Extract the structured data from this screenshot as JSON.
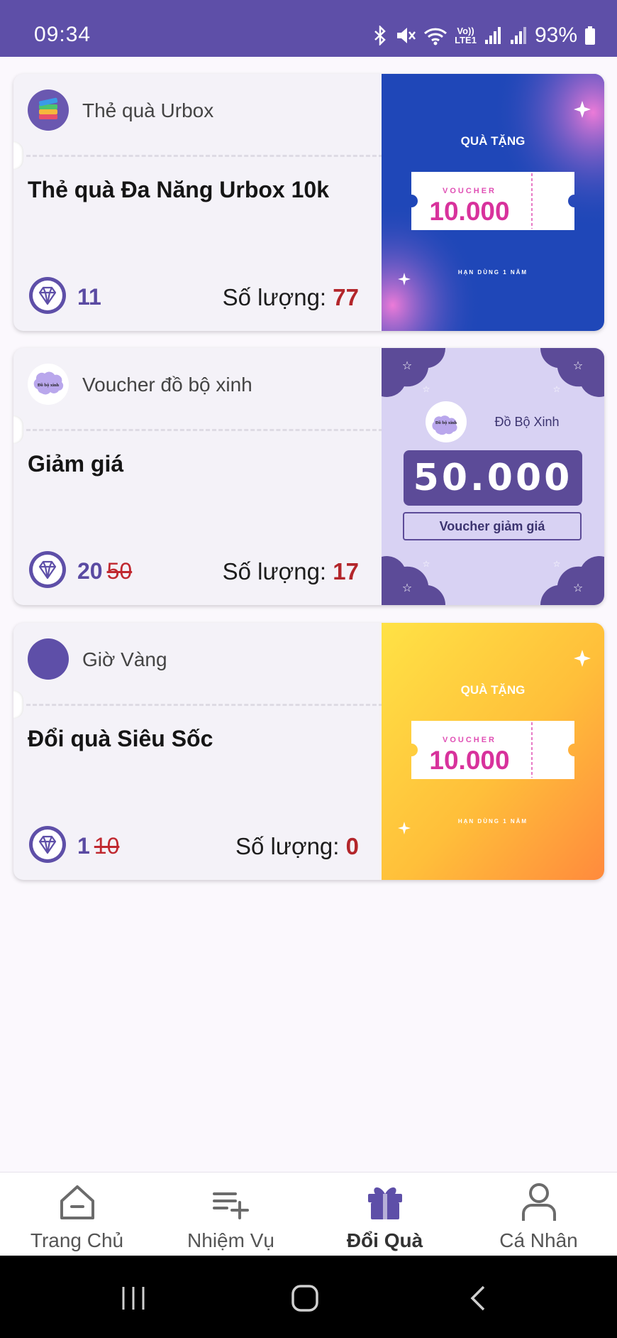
{
  "status_bar": {
    "time": "09:34",
    "battery": "93%",
    "network": "LTE1",
    "volte": "Vo))",
    "icons": [
      "bluetooth-icon",
      "mute-icon",
      "wifi-icon",
      "signal-icon",
      "signal-icon",
      "battery-icon"
    ]
  },
  "gifts": [
    {
      "brand": "Thẻ quà Urbox",
      "title": "Thẻ quà Đa Năng Urbox 10k",
      "points": "11",
      "old_points": "",
      "quantity_label": "Số lượng:",
      "quantity": "77",
      "image": {
        "heading": "QUÀ TẶNG",
        "ticket_label": "VOUCHER",
        "value": "10.000",
        "footer": "HẠN DÙNG 1 NĂM",
        "colors": [
          "#1f47b8",
          "#ec7bd8"
        ]
      }
    },
    {
      "brand": "Voucher đồ bộ xinh",
      "brand_logo_text": "Đồ bộ xinh",
      "title": "Giảm giá",
      "points": "20",
      "old_points": "50",
      "quantity_label": "Số lượng:",
      "quantity": "17",
      "image": {
        "brand": "Đồ Bộ Xinh",
        "value": "50.000",
        "caption": "Voucher giảm giá",
        "colors": [
          "#d8d2f3",
          "#5c4b98"
        ]
      }
    },
    {
      "brand": "Giờ Vàng",
      "title": "Đổi quà Siêu Sốc",
      "points": "1",
      "old_points": "10",
      "quantity_label": "Số lượng:",
      "quantity": "0",
      "image": {
        "heading": "QUÀ TẶNG",
        "ticket_label": "VOUCHER",
        "value": "10.000",
        "footer": "HẠN DÙNG 1 NĂM",
        "colors": [
          "#ffd83a",
          "#ff8a3d"
        ]
      }
    }
  ],
  "nav": {
    "items": [
      {
        "label": "Trang Chủ",
        "icon": "home-icon"
      },
      {
        "label": "Nhiệm Vụ",
        "icon": "task-list-add-icon"
      },
      {
        "label": "Đổi Quà",
        "icon": "gift-icon",
        "active": true
      },
      {
        "label": "Cá Nhân",
        "icon": "user-icon"
      }
    ],
    "active_color": "#5e4fa8"
  }
}
